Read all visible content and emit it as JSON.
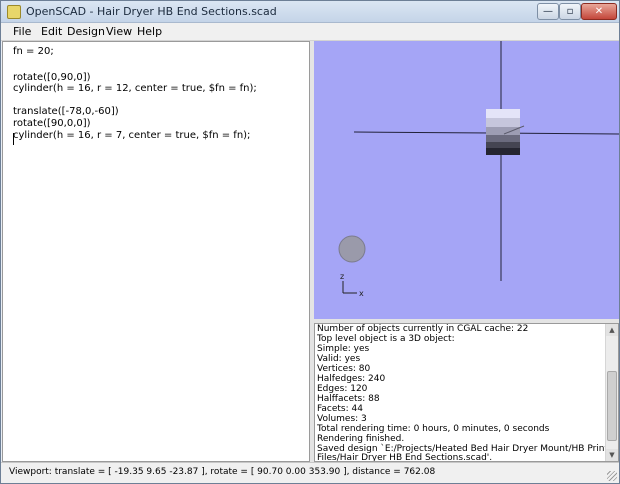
{
  "window": {
    "title": "OpenSCAD - Hair Dryer HB End Sections.scad",
    "minimize_glyph": "—",
    "maximize_glyph": "▫",
    "close_glyph": "✕"
  },
  "menu": [
    "File",
    "Edit",
    "Design",
    "View",
    "Help"
  ],
  "editor": {
    "lines": [
      "fn = 20;",
      "",
      "rotate([0,90,0])",
      "cylinder(h = 16, r = 12, center = true, $fn = fn);",
      "",
      "translate([-78,0,-60])",
      "rotate([90,0,0])",
      "cylinder(h = 16, r = 7, center = true, $fn = fn);"
    ]
  },
  "viewport": {
    "background_color": "#a5a5f6",
    "axis_z_label": "z",
    "axis_x_label": "x"
  },
  "console": {
    "lines": [
      "Number of objects currently in CGAL cache: 22",
      "   Top level object is a 3D object:",
      "   Simple:        yes",
      "   Valid:         yes",
      "   Vertices:      80",
      "   Halfedges:     240",
      "   Edges:         120",
      "   Halffacets:    88",
      "   Facets:        44",
      "   Volumes:       3",
      "Total rendering time: 0 hours, 0 minutes, 0 seconds",
      "Rendering finished.",
      "Saved design `E:/Projects/Heated Bed Hair Dryer Mount/HB Printing",
      "Files/Hair Dryer HB End Sections.scad'."
    ]
  },
  "statusbar": {
    "text": "Viewport: translate = [ -19.35 9.65 -23.87 ], rotate = [ 90.70 0.00 353.90 ], distance = 762.08"
  },
  "icons": {
    "app": "openscad-app-icon",
    "scroll_up": "▲",
    "scroll_down": "▼"
  }
}
